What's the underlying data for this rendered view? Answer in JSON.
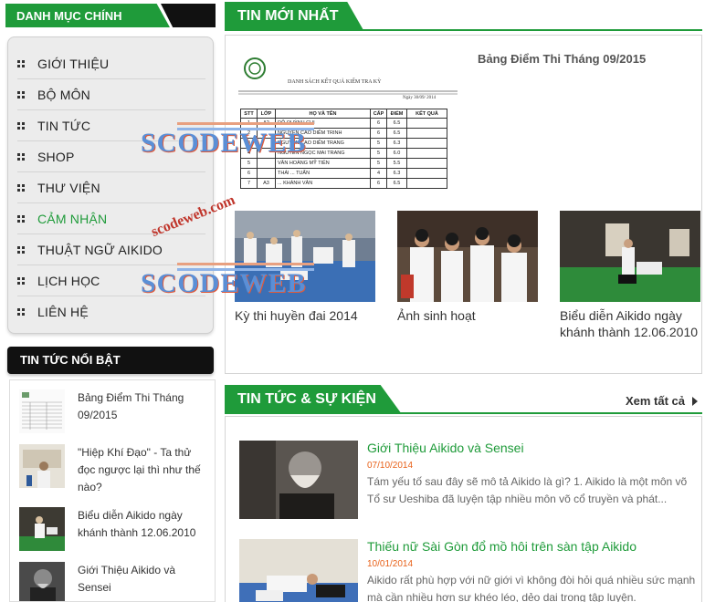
{
  "sidebar": {
    "title": "DANH MỤC CHÍNH",
    "items": [
      {
        "label": "GIỚI THIỆU"
      },
      {
        "label": "BỘ MÔN"
      },
      {
        "label": "TIN TỨC"
      },
      {
        "label": "SHOP"
      },
      {
        "label": "THƯ VIỆN"
      },
      {
        "label": "CẢM NHẬN"
      },
      {
        "label": "THUẬT NGỮ AIKIDO"
      },
      {
        "label": "LỊCH HỌC"
      },
      {
        "label": "LIÊN HỆ"
      }
    ],
    "active_index": 5
  },
  "featured": {
    "title": "TIN TỨC NỔI BẬT",
    "items": [
      {
        "title": "Bảng Điểm Thi Tháng 09/2015"
      },
      {
        "title": "\"Hiệp Khí Đạo\" - Ta thử đọc ngược lại thì như thế nào?"
      },
      {
        "title": "Biểu diễn Aikido ngày khánh thành 12.06.2010"
      },
      {
        "title": "Giới Thiệu Aikido và Sensei"
      }
    ]
  },
  "latest": {
    "title": "TIN MỚI NHẤT",
    "main_title": "Bảng Điểm Thi Tháng 09/2015",
    "doc": {
      "heading": "DANH SÁCH KẾT QUẢ KIỂM TRA KỲ",
      "date": "Ngày 30/09/ 2014",
      "columns": [
        "STT",
        "LỚP",
        "HỌ VÀ TÊN",
        "CẤP",
        "ĐIỂM",
        "KẾT QUẢ"
      ],
      "rows": [
        [
          "1",
          "A2",
          "ĐỖ QUỲNH CHI",
          "6",
          "6.5",
          ""
        ],
        [
          "2",
          "",
          "NGUYỄN CAO DIỄM TRINH",
          "6",
          "6.5",
          ""
        ],
        [
          "3",
          "",
          "NGUYỄN CAO DIỄM TRANG",
          "5",
          "6.3",
          ""
        ],
        [
          "4",
          "",
          "NGUYỄN NGỌC MAI TRANG",
          "5",
          "6.0",
          ""
        ],
        [
          "5",
          "",
          "VĂN HOÀNG MỸ TIÊN",
          "5",
          "5.5",
          ""
        ],
        [
          "6",
          "",
          "THÁI ... TUẤN",
          "4",
          "6.3",
          ""
        ],
        [
          "7",
          "A3",
          "... KHÁNH VÂN",
          "6",
          "6.5",
          ""
        ]
      ]
    },
    "cards": [
      {
        "caption": "Kỳ thi huyền đai 2014"
      },
      {
        "caption": "Ảnh sinh hoạt"
      },
      {
        "caption": "Biểu diễn Aikido ngày khánh thành 12.06.2010"
      }
    ]
  },
  "events": {
    "title": "TIN TỨC & SỰ KIỆN",
    "see_all": "Xem tất cả",
    "items": [
      {
        "title": "Giới Thiệu Aikido và Sensei",
        "date": "07/10/2014",
        "summary": "Tám yếu tố sau đây sẽ mô tả Aikido là gì? 1. Aikido là một môn võ Tổ sư Ueshiba đã luyện tập nhiều môn võ cổ truyền và phát..."
      },
      {
        "title": "Thiếu nữ Sài Gòn đổ mồ hôi trên sàn tập Aikido",
        "date": "10/01/2014",
        "summary": "Aikido rất phù hợp với nữ giới vì không đòi hỏi quá nhiều sức mạnh mà cần nhiều hơn sự khéo léo, dẻo dai trong tập luyện."
      }
    ]
  },
  "watermark": {
    "brand": "SCODEWEB",
    "url": "scodeweb.com"
  },
  "colors": {
    "accent": "#1f9b3a",
    "date": "#e8621a",
    "dark": "#111111"
  }
}
